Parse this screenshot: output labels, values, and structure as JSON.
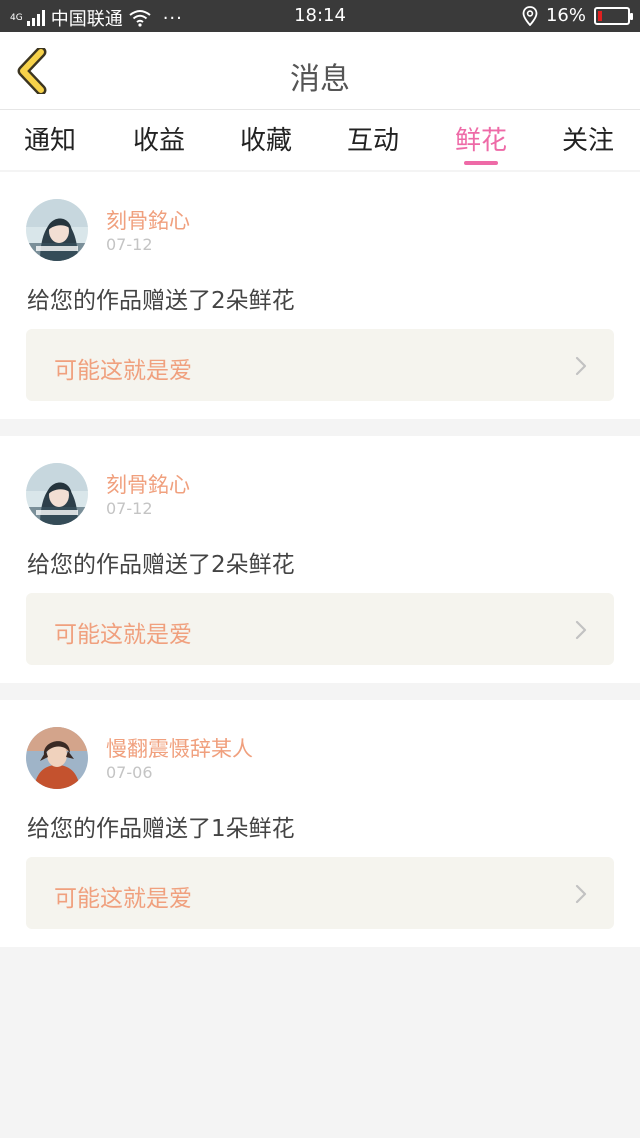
{
  "status_bar": {
    "network": "4G",
    "carrier": "中国联通",
    "more": "···",
    "time": "18:14",
    "battery": "16%",
    "battery_level": 0.16
  },
  "header": {
    "title": "消息"
  },
  "tabs": [
    {
      "label": "通知",
      "active": false
    },
    {
      "label": "收益",
      "active": false
    },
    {
      "label": "收藏",
      "active": false
    },
    {
      "label": "互动",
      "active": false
    },
    {
      "label": "鲜花",
      "active": true
    },
    {
      "label": "关注",
      "active": false
    }
  ],
  "messages": [
    {
      "user": "刻骨銘心",
      "date": "07-12",
      "text": "给您的作品赠送了2朵鲜花",
      "work": "可能这就是爱",
      "avatar_icon": "girl-avatar-icon"
    },
    {
      "user": "刻骨銘心",
      "date": "07-12",
      "text": "给您的作品赠送了2朵鲜花",
      "work": "可能这就是爱",
      "avatar_icon": "girl-avatar-icon"
    },
    {
      "user": "慢翻震慑辞某人",
      "date": "07-06",
      "text": "给您的作品赠送了1朵鲜花",
      "work": "可能这就是爱",
      "avatar_icon": "boy-avatar-icon"
    }
  ],
  "colors": {
    "accent": "#ee6aa7",
    "name": "#f0a07e",
    "back_arrow": "#f7d24a"
  }
}
